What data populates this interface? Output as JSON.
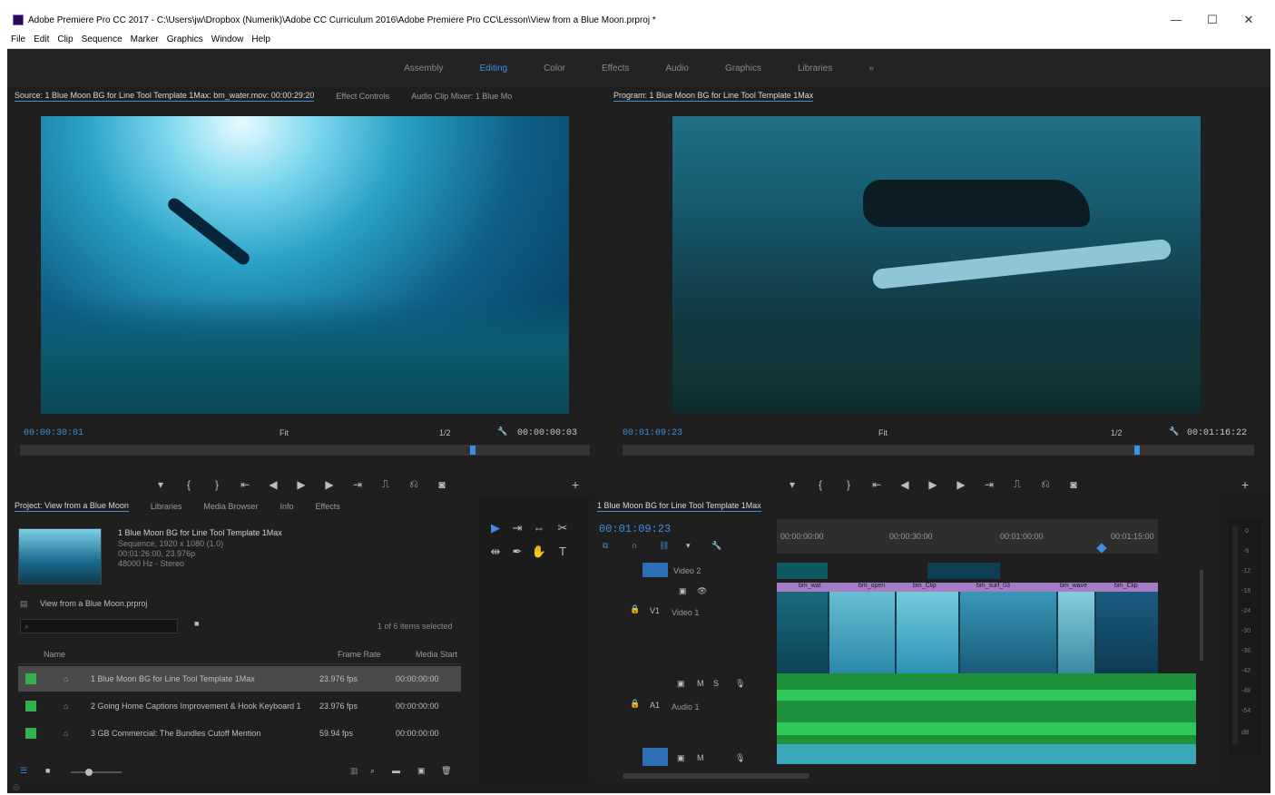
{
  "window": {
    "title": "Adobe Premiere Pro CC 2017 - C:\\Users\\jw\\Dropbox (Numerik)\\Adobe CC Curriculum 2016\\Adobe Premiere Pro CC\\Lesson\\View from a Blue Moon.prproj *",
    "minimize": "—",
    "maximize": "☐",
    "close": "✕"
  },
  "menu": [
    "File",
    "Edit",
    "Clip",
    "Sequence",
    "Marker",
    "Graphics",
    "Window",
    "Help"
  ],
  "workspaces": {
    "items": [
      "Assembly",
      "Editing",
      "Color",
      "Effects",
      "Audio",
      "Graphics",
      "Libraries"
    ],
    "active_index": 1,
    "more": "»"
  },
  "source": {
    "tabs": [
      "Source: 1 Blue Moon BG for Line Tool Template 1Max: bm_water.mov: 00:00:29:20",
      "Effect Controls",
      "Audio Clip Mixer: 1 Blue Mo"
    ],
    "timecode": "00:00:30:01",
    "fit": "Fit",
    "resolution": "1/2",
    "duration": "00:00:00:03",
    "playhead_fraction": 0.79
  },
  "program": {
    "tabs": [
      "Program: 1 Blue Moon BG for Line Tool Template 1Max"
    ],
    "timecode": "00:01:09:23",
    "fit": "Fit",
    "resolution": "1/2",
    "duration": "00:01:16:22",
    "playhead_fraction": 0.81
  },
  "transport": {
    "icons": [
      "marker-icon",
      "mark-in-icon",
      "mark-out-icon",
      "go-to-in-icon",
      "step-back-icon",
      "play-icon",
      "step-forward-icon",
      "go-to-out-icon",
      "insert-icon",
      "overwrite-icon",
      "export-frame-icon"
    ],
    "glyphs": [
      "▾",
      "{",
      "}",
      "⇤",
      "◀",
      "▶",
      "▶",
      "⇥",
      "⎍",
      "⎌",
      "◙"
    ],
    "add": "+"
  },
  "project": {
    "tabs": [
      "Project: View from a Blue Moon",
      "Libraries",
      "Media Browser",
      "Info",
      "Effects"
    ],
    "clip_name": "1 Blue Moon BG for Line Tool Template 1Max",
    "clip_info": [
      "Sequence, 1920 x 1080 (1.0)",
      "00:01:26:00, 23.976p",
      "48000 Hz - Stereo"
    ],
    "project_file": "View from a Blue Moon.prproj",
    "search_placeholder": "",
    "selection": "1 of 6 items selected",
    "columns": {
      "name": "Name",
      "frame_rate": "Frame Rate",
      "media_start": "Media Start"
    },
    "rows": [
      {
        "name": "1 Blue Moon BG for Line Tool Template 1Max",
        "frame_rate": "23.976 fps",
        "media_start": "00:00:00:00",
        "selected": true
      },
      {
        "name": "2 Going Home Captions Improvement & Hook Keyboard 1",
        "frame_rate": "23.976 fps",
        "media_start": "00:00:00:00",
        "selected": false
      },
      {
        "name": "3 GB Commercial: The Bundles Cutoff Mention",
        "frame_rate": "59.94 fps",
        "media_start": "00:00:00:00",
        "selected": false
      }
    ]
  },
  "timeline": {
    "tab": "1 Blue Moon BG for Line Tool Template 1Max",
    "timecode": "00:01:09:23",
    "ruler": [
      "00:00:00:00",
      "00:00:30:00",
      "00:01:00:00",
      "00:01:15:00"
    ],
    "v2": "Video 2",
    "v1_label": "V1",
    "v1": "Video 1",
    "a1_label": "A1",
    "a1": "Audio 1",
    "clip_labels": [
      "bm_wat",
      "bm_open",
      "bm_Clip",
      "bm_surf_03",
      "bm_wave",
      "bm_Clip"
    ]
  },
  "meter": {
    "labels": [
      "0",
      "-6",
      "-12",
      "-18",
      "-24",
      "-30",
      "-36",
      "-42",
      "-48",
      "-54",
      "dB"
    ]
  },
  "colors": {
    "accent": "#3d8ee0",
    "label_green": "#31b04c",
    "clip_violet": "#a57cc6",
    "audio_green": "#1e8f3a",
    "audio_teal": "#3aa6b8",
    "panel_bg": "#1d1d1d"
  }
}
